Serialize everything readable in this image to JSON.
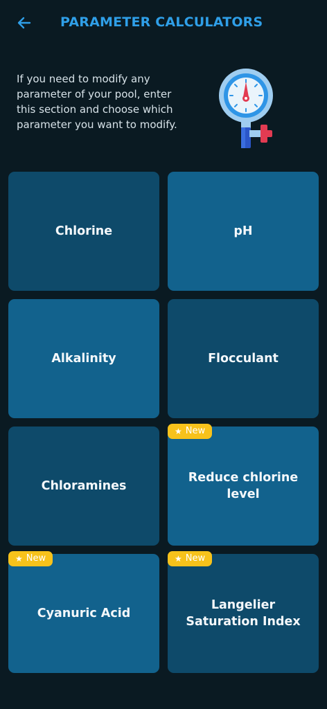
{
  "header": {
    "title": "PARAMETER CALCULATORS",
    "back_icon": "arrow-left-icon",
    "accent_color": "#2f9fe8"
  },
  "intro": {
    "text": "If you need to modify any parameter of your pool, enter this section and choose which parameter you want to modify.",
    "illustration": "pressure-gauge-icon"
  },
  "badge_label": "New",
  "cards": [
    {
      "label": "Chlorine",
      "new": false
    },
    {
      "label": "pH",
      "new": false
    },
    {
      "label": "Alkalinity",
      "new": false
    },
    {
      "label": "Flocculant",
      "new": false
    },
    {
      "label": "Chloramines",
      "new": false
    },
    {
      "label": "Reduce chlorine level",
      "new": true
    },
    {
      "label": "Cyanuric Acid",
      "new": true
    },
    {
      "label": "Langelier Saturation Index",
      "new": true
    }
  ],
  "colors": {
    "background": "#0a1a22",
    "card_dark": "#0e4a6a",
    "card_light": "#12628d",
    "badge": "#f7c21b"
  }
}
